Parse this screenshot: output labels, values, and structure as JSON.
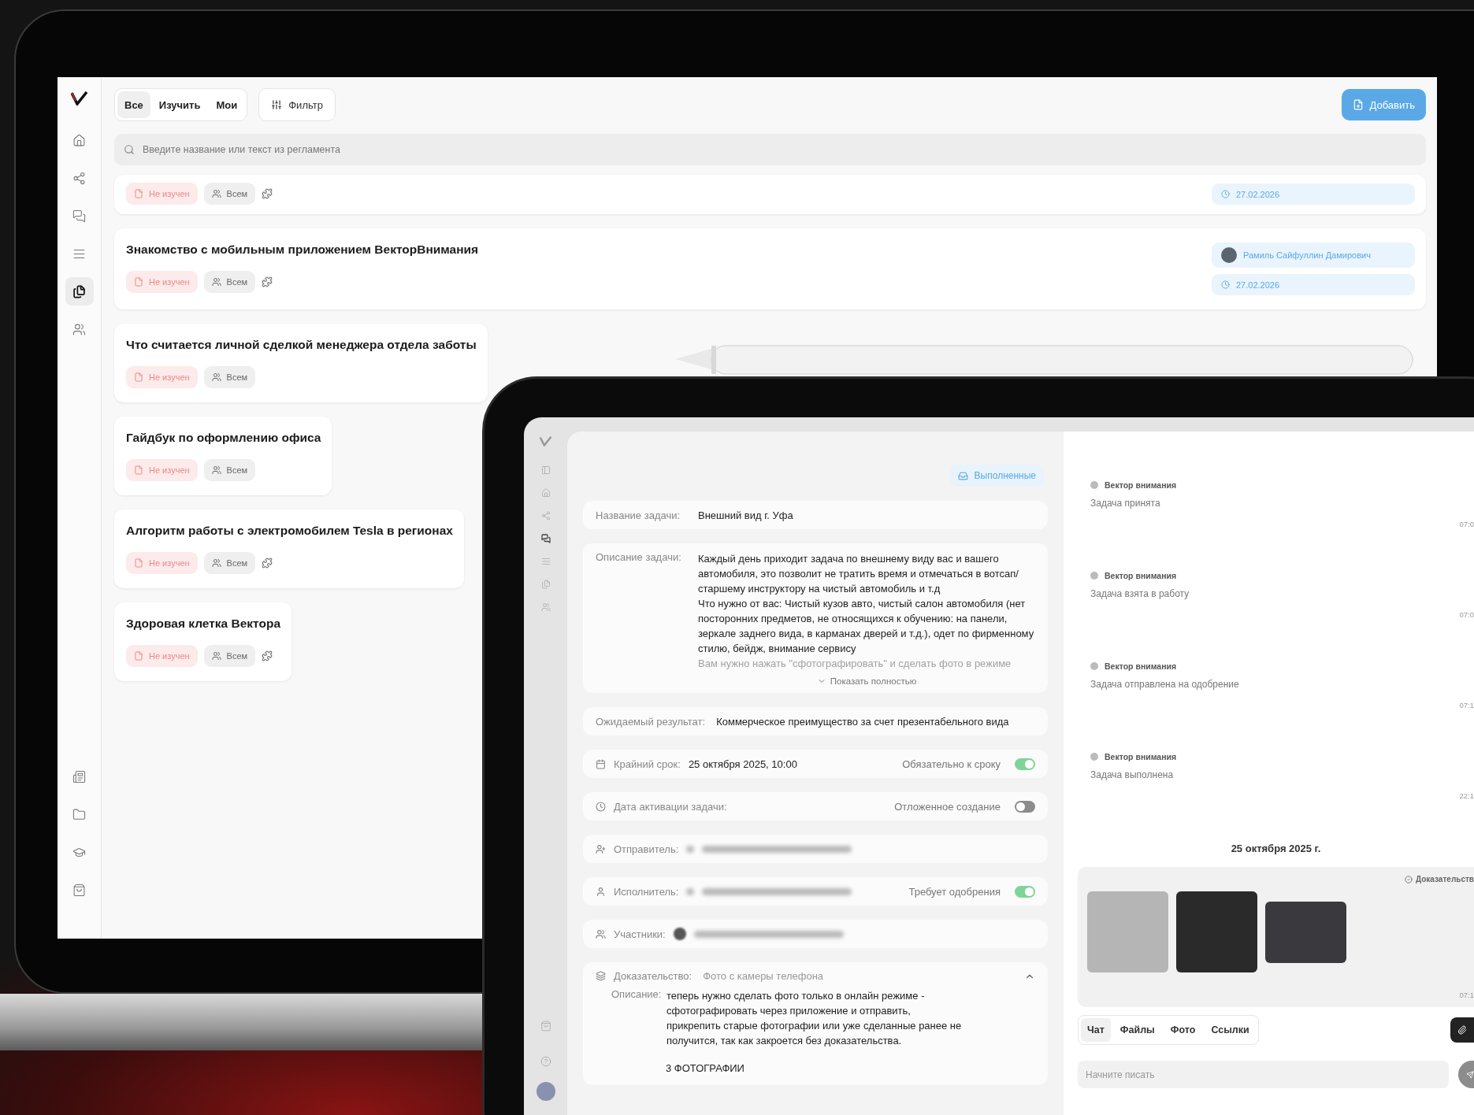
{
  "laptop": {
    "sidebar": {
      "items": [
        {
          "kind": "home",
          "selected": false
        },
        {
          "kind": "share",
          "selected": false
        },
        {
          "kind": "chat",
          "selected": false
        },
        {
          "kind": "list",
          "selected": false
        },
        {
          "kind": "documents",
          "selected": true
        },
        {
          "kind": "users",
          "selected": false
        }
      ],
      "bottom_items": [
        {
          "kind": "news"
        },
        {
          "kind": "folder"
        },
        {
          "kind": "education"
        },
        {
          "kind": "shop"
        }
      ]
    },
    "filter_tabs": [
      {
        "label": "Все",
        "selected": true
      },
      {
        "label": "Изучить",
        "selected": false
      },
      {
        "label": "Мои",
        "selected": false
      }
    ],
    "filter_button": "Фильтр",
    "add_button": "Добавить",
    "search": {
      "placeholder": "Введите название или текст из регламента"
    },
    "cards": [
      {
        "status": "Не изучен",
        "audience": "Всем",
        "puzzle": true,
        "date": "27.02.2026"
      },
      {
        "title": "Знакомство с мобильным приложением ВекторВнимания",
        "status": "Не изучен",
        "audience": "Всем",
        "puzzle": true,
        "author": "Рамиль Сайфуллин Дамирович",
        "date": "27.02.2026"
      },
      {
        "title": "Что считается личной сделкой менеджера отдела заботы",
        "status": "Не изучен",
        "audience": "Всем",
        "puzzle": false
      },
      {
        "title": "Гайдбук по оформлению офиса",
        "status": "Не изучен",
        "audience": "Всем",
        "puzzle": false
      },
      {
        "title": "Алгоритм работы с электромобилем Tesla в регионах",
        "status": "Не изучен",
        "audience": "Всем",
        "puzzle": true
      },
      {
        "title": "Здоровая клетка Вектора",
        "status": "Не изучен",
        "audience": "Всем",
        "puzzle": true
      }
    ]
  },
  "tablet": {
    "sidebar": {
      "items": [
        {
          "kind": "panel",
          "selected": false
        },
        {
          "kind": "home",
          "selected": false
        },
        {
          "kind": "share",
          "selected": false
        },
        {
          "kind": "chat",
          "selected": true
        },
        {
          "kind": "list",
          "selected": false
        },
        {
          "kind": "documents",
          "selected": false
        },
        {
          "kind": "users",
          "selected": false
        }
      ],
      "bottom_items": [
        {
          "kind": "shop"
        },
        {
          "kind": "help"
        },
        {
          "kind": "avatar"
        }
      ]
    },
    "status_badge": "Выполненные",
    "task": {
      "name": {
        "label": "Название задачи:",
        "value": "Внешний вид г. Уфа"
      },
      "description": {
        "label": "Описание задачи:",
        "paragraphs": [
          "Каждый день приходит задача по внешнему виду вас и вашего автомобиля, это позволит не тратить время и отмечаться в вотсап/старшему инструктору на чистый автомобиль и т.д",
          "Что нужно от вас: Чистый кузов авто, чистый салон автомобиля (нет посторонних предметов, не относящихся к обучению: на панели, зеркале заднего вида, в карманах дверей и т.д.), одет по фирменному стилю, бейдж, внимание сервису"
        ],
        "faded": "Вам нужно нажать \"сфотографировать\" и сделать фото в режиме",
        "show_more": "Показать полностью"
      },
      "result": {
        "label": "Ожидаемый результат:",
        "value": "Коммерческое преимущество за счет презентабельного вида"
      },
      "deadline": {
        "label": "Крайний срок:",
        "value": "25 октября 2025, 10:00",
        "toggle_label": "Обязательно к сроку",
        "checked": true
      },
      "activation": {
        "label": "Дата активации задачи:",
        "toggle_label": "Отложенное создание",
        "checked": false
      },
      "sender": {
        "label": "Отправитель:"
      },
      "executor": {
        "label": "Исполнитель:",
        "toggle_label": "Требует одобрения",
        "checked": true
      },
      "participants": {
        "label": "Участники:"
      },
      "proof": {
        "label": "Доказательство:",
        "value": "Фото с камеры телефона",
        "expanded": true,
        "description_label": "Описание:",
        "description": "теперь нужно сделать фото только в онлайн режиме - сфотографировать через приложение и отправить, прикрепить старые фотографии или уже сделанные ранее не получится, так как закроется без доказательства.",
        "photos_label": "3 ФОТОГРАФИИ"
      }
    },
    "chat": {
      "messages": [
        {
          "sender": "Вектор внимания",
          "text": "Задача принята",
          "time": "07:0"
        },
        {
          "sender": "Вектор внимания",
          "text": "Задача взята в работу",
          "time": "07:0"
        },
        {
          "sender": "Вектор внимания",
          "text": "Задача отправлена на одобрение",
          "time": "07:1"
        },
        {
          "sender": "Вектор внимания",
          "text": "Задача выполнена",
          "time": "22:1"
        }
      ],
      "date": "25 октября 2025 г.",
      "proof": {
        "label": "Доказательств",
        "time": "07:1",
        "photos": [
          {
            "wide": false
          },
          {
            "wide": false
          },
          {
            "wide": true
          }
        ]
      },
      "tabs": [
        {
          "label": "Чат",
          "selected": true
        },
        {
          "label": "Файлы",
          "selected": false
        },
        {
          "label": "Фото",
          "selected": false
        },
        {
          "label": "Ссылки",
          "selected": false
        }
      ],
      "input": {
        "placeholder": "Начните писать"
      }
    }
  }
}
